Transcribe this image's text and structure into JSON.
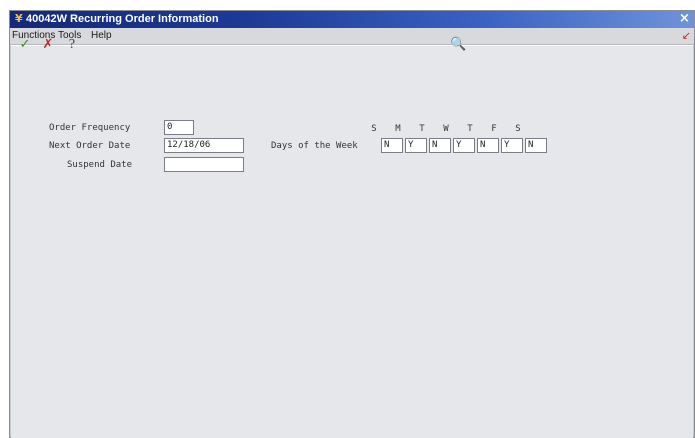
{
  "window": {
    "title": "40042W  Recurring Order Information",
    "colors": {
      "titlebar": "#1d3a96",
      "content_bg": "#e6e7ea",
      "field_bg": "#ffffff"
    }
  },
  "menu": {
    "functions": "Functions",
    "tools": "Tools",
    "help": "Help"
  },
  "toolbar": {
    "ok_icon": "✓",
    "cancel_icon": "✗",
    "help_icon": "?",
    "search_icon": "🔍"
  },
  "form": {
    "order_frequency": {
      "label": "Order Frequency",
      "value": "0"
    },
    "next_order_date": {
      "label": "Next Order Date",
      "value": "12/18/06"
    },
    "suspend_date": {
      "label": "Suspend Date",
      "value": ""
    },
    "days_of_week": {
      "label": "Days of the Week",
      "headers": [
        "S",
        "M",
        "T",
        "W",
        "T",
        "F",
        "S"
      ],
      "values": [
        "N",
        "Y",
        "N",
        "Y",
        "N",
        "Y",
        "N"
      ]
    }
  }
}
